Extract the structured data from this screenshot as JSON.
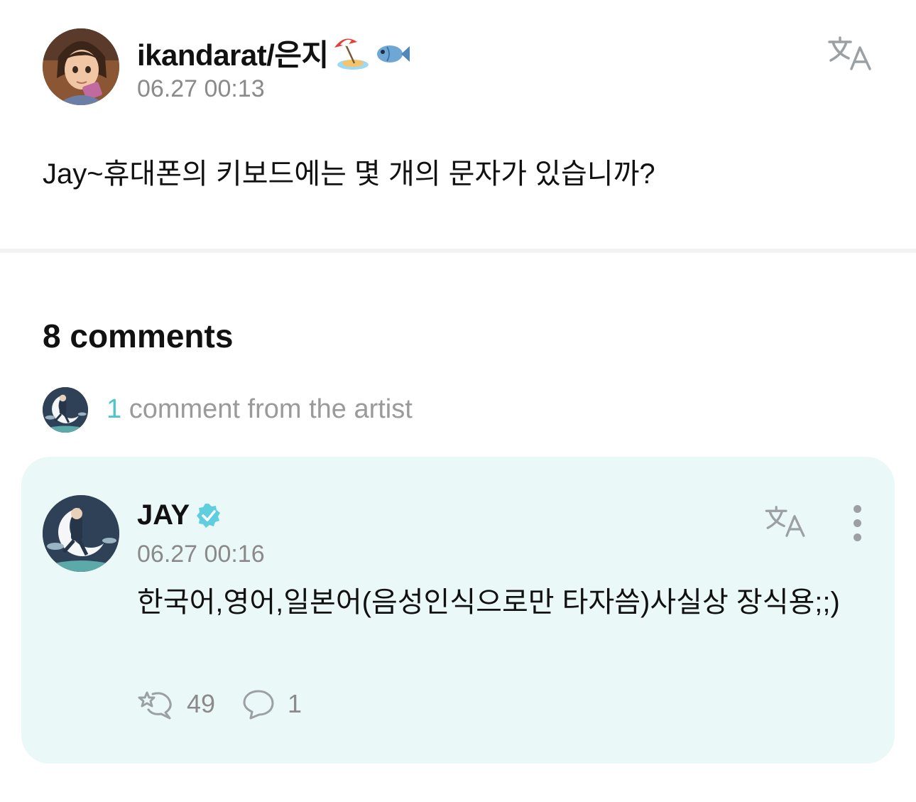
{
  "post": {
    "username": "ikandarat/은지",
    "username_icons": [
      "beach-umbrella-icon",
      "fish-icon"
    ],
    "timestamp": "06.27 00:13",
    "body": "Jay~휴대폰의 키보드에는 몇 개의 문자가 있습니까?"
  },
  "comments": {
    "count_label": "8 comments",
    "artist_summary": {
      "number": "1",
      "text": " comment from the artist"
    }
  },
  "artist_comment": {
    "name": "JAY",
    "verified_icon": "verified-badge-icon",
    "timestamp": "06.27 00:16",
    "body": "한국어,영어,일본어(음성인식으로만 타자씀)사실상 장식용;;)",
    "likes": "49",
    "replies": "1"
  },
  "icons": {
    "translate": "translate-icon",
    "more": "more-vertical-icon",
    "like": "like-icon",
    "reply": "reply-bubble-icon"
  },
  "colors": {
    "accent": "#4cc7c9",
    "card_background": "#eaf8f7",
    "muted_text": "#8a8a8a",
    "icon_gray": "#9aa0a4"
  }
}
